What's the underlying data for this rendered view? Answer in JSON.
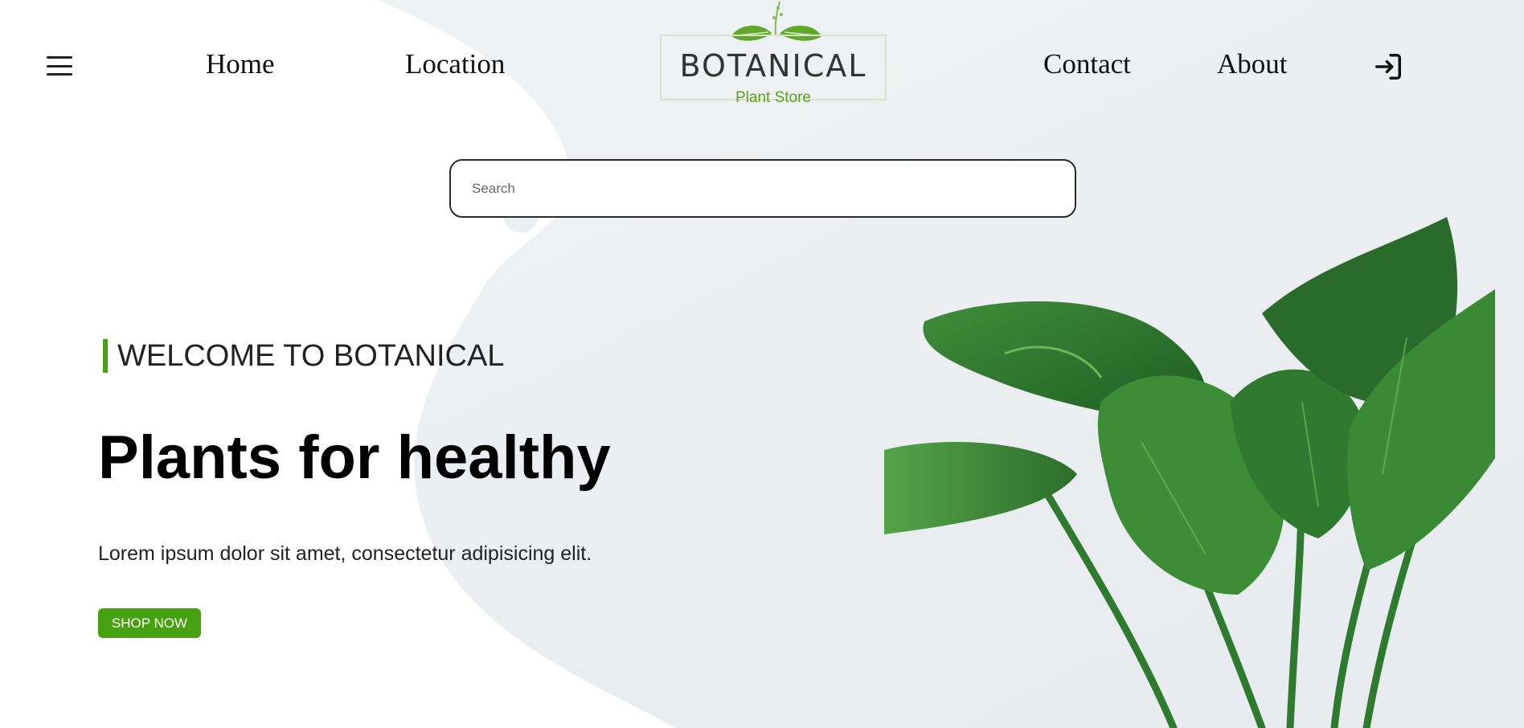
{
  "colors": {
    "accent_green": "#47a10f",
    "background": "#eef0f2",
    "text_dark": "#111111"
  },
  "nav": {
    "menu_icon": "hamburger-menu-icon",
    "links": [
      {
        "label": "Home"
      },
      {
        "label": "Location"
      },
      {
        "label": "Contact"
      },
      {
        "label": "About"
      }
    ],
    "login_icon": "sign-in-icon"
  },
  "logo": {
    "title": "BOTANICAL",
    "subtitle": "Plant Store",
    "icon": "leaf-sprig-icon"
  },
  "search": {
    "placeholder": "Search",
    "value": ""
  },
  "hero": {
    "welcome": "WELCOME TO BOTANICAL",
    "headline": "Plants for healthy",
    "subtext": "Lorem ipsum dolor sit amet, consectetur adipisicing elit.",
    "cta_label": "SHOP NOW"
  },
  "decor": {
    "plant_image": "elephant-ear-plant-image"
  }
}
